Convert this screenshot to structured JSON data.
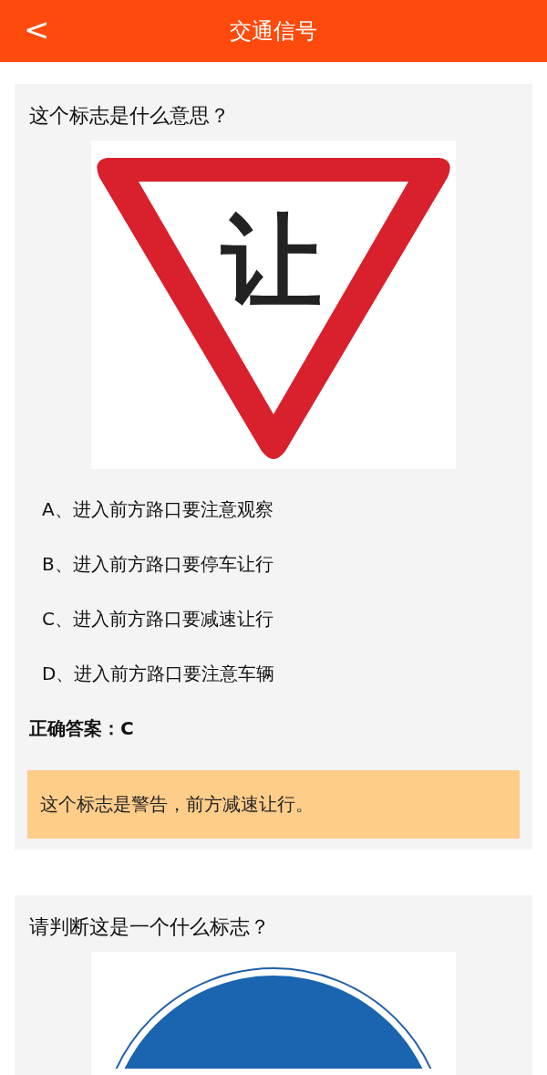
{
  "header": {
    "title": "交通信号",
    "back": "<"
  },
  "questions": [
    {
      "question": "这个标志是什么意思？",
      "sign": {
        "kind": "yield",
        "text": "让"
      },
      "options": [
        "A、进入前方路口要注意观察",
        "B、进入前方路口要停车让行",
        "C、进入前方路口要减速让行",
        "D、进入前方路口要注意车辆"
      ],
      "answer": "正确答案：C",
      "explanation": "这个标志是警告，前方减速让行。"
    },
    {
      "question": "请判断这是一个什么标志？",
      "sign": {
        "kind": "round"
      }
    }
  ]
}
